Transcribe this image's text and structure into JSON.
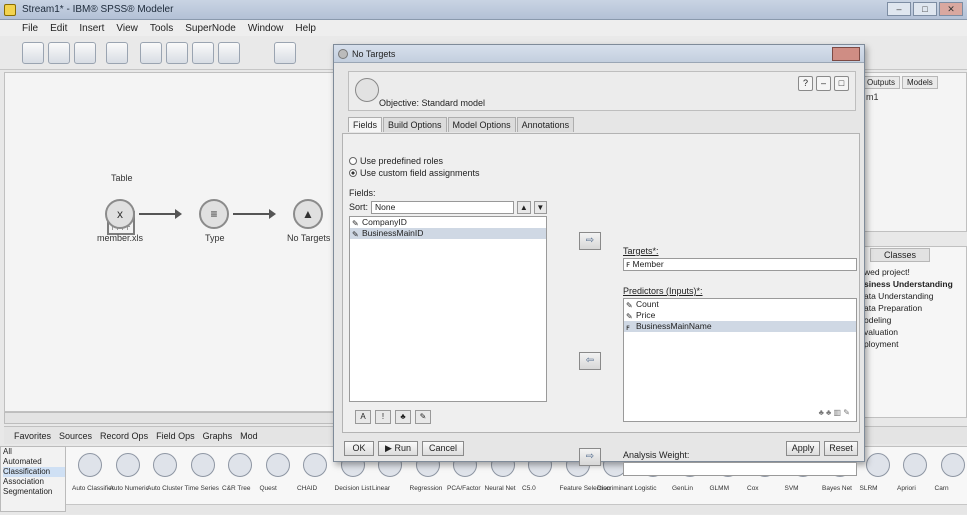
{
  "window": {
    "title": "Stream1* - IBM® SPSS® Modeler",
    "controls": {
      "minimize": "–",
      "maximize": "□",
      "close": "✕"
    }
  },
  "menu": [
    "File",
    "Edit",
    "Insert",
    "View",
    "Tools",
    "SuperNode",
    "Window",
    "Help"
  ],
  "canvas": {
    "nodes": {
      "table": "Table",
      "source": "member.xls",
      "type": "Type",
      "target": "No Targets"
    }
  },
  "right_panel": {
    "tabs": [
      "Outputs",
      "Models"
    ],
    "stream_name": "m1",
    "classes_tab": "Classes",
    "crisp": [
      "wed project!",
      "siness Understanding",
      "ata Understanding",
      "ata Preparation",
      "odeling",
      "valuation",
      "ployment"
    ]
  },
  "palette": {
    "tabs": [
      "Favorites",
      "Sources",
      "Record Ops",
      "Field Ops",
      "Graphs",
      "Mod"
    ],
    "categories": [
      "All",
      "Automated",
      "Classification",
      "Association",
      "Segmentation"
    ],
    "nodes": [
      "Auto Classifier",
      "Auto Numeric",
      "Auto Cluster",
      "Time Series",
      "C&R Tree",
      "Quest",
      "CHAID",
      "Decision List",
      "Linear",
      "Regression",
      "PCA/Factor",
      "Neural Net",
      "C5.0",
      "Feature Selection",
      "Discriminant",
      "Logistic",
      "GenLin",
      "GLMM",
      "Cox",
      "SVM",
      "Bayes Net",
      "SLRM",
      "Apriori",
      "Carn"
    ]
  },
  "dialog": {
    "title": "No Targets",
    "objective": "Objective: Standard model",
    "tabs": [
      "Fields",
      "Build Options",
      "Model Options",
      "Annotations"
    ],
    "radio_predefined": "Use predefined roles",
    "radio_custom": "Use custom field assignments",
    "fields_label": "Fields:",
    "sort_label": "Sort:",
    "sort_value": "None",
    "fields": [
      "CompanyID",
      "BusinessMainID"
    ],
    "targets_label": "Targets*:",
    "target_value": "Member",
    "predictors_label": "Predictors (Inputs)*:",
    "predictors": [
      "Count",
      "Price",
      "BusinessMainName"
    ],
    "weight_label": "Analysis Weight:",
    "weight_value": "",
    "buttons": {
      "ok": "OK",
      "run": "▶ Run",
      "cancel": "Cancel",
      "apply": "Apply",
      "reset": "Reset"
    }
  }
}
